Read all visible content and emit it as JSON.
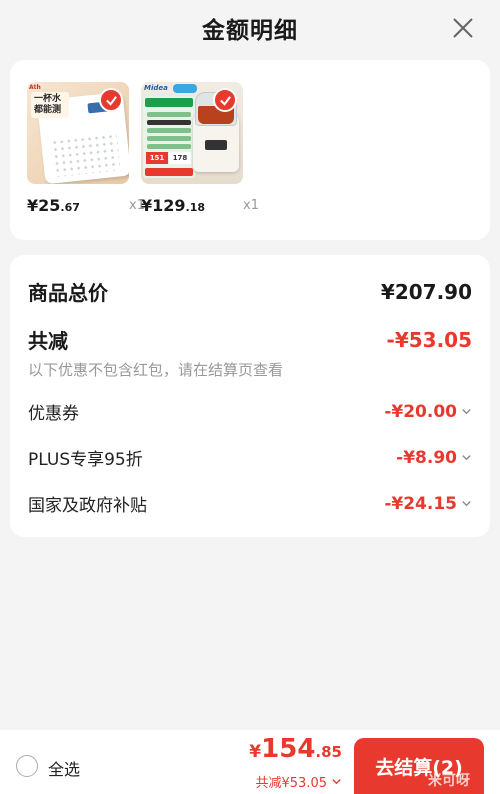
{
  "header": {
    "title": "金额明细"
  },
  "products": [
    {
      "price_symbol": "¥",
      "price_int": "25",
      "price_dec": ".67",
      "qty": "x1",
      "image_text": "一杯水都能测",
      "brand": "Ath"
    },
    {
      "price_symbol": "¥",
      "price_int": "129",
      "price_dec": ".18",
      "qty": "x1",
      "brand": "Midea",
      "promo_1": "151",
      "promo_2": "178"
    }
  ],
  "summary": {
    "total_label": "商品总价",
    "total_value": "¥207.90",
    "discount_label": "共减",
    "discount_value": "-¥53.05",
    "note": "以下优惠不包含红包，请在结算页查看",
    "items": [
      {
        "label": "优惠券",
        "value": "-¥20.00"
      },
      {
        "label": "PLUS专享95折",
        "value": "-¥8.90"
      },
      {
        "label": "国家及政府补贴",
        "value": "-¥24.15"
      }
    ]
  },
  "bottom": {
    "select_all": "全选",
    "total_symbol": "¥",
    "total_int": "154",
    "total_dec": ".85",
    "total_discount": "共减¥53.05",
    "checkout_label": "去结算(2)",
    "watermark": "米可呀"
  },
  "colors": {
    "accent": "#e8392e",
    "muted": "#999999",
    "background": "#f4f4f4"
  },
  "icons": {
    "close": "close-icon",
    "check": "check-icon",
    "chevron": "chevron-down-icon",
    "radio": "radio-unchecked-icon"
  }
}
